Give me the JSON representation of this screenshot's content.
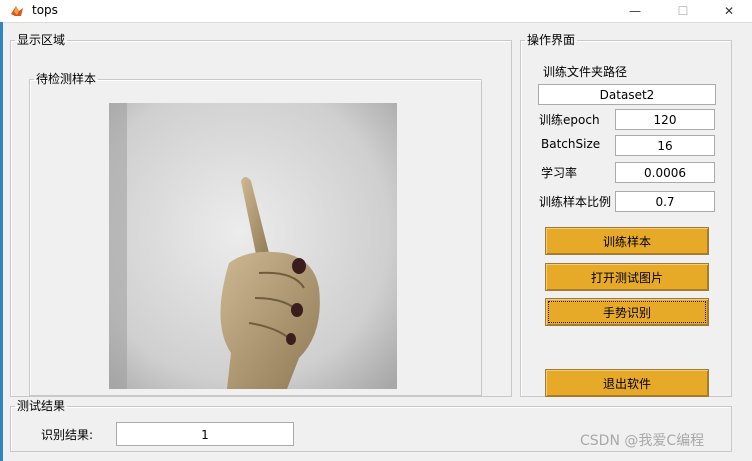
{
  "window": {
    "title": "tops",
    "minimize": "—",
    "maximize": "☐",
    "close": "✕"
  },
  "display_panel": {
    "title": "显示区域",
    "sample_group": "待检测样本"
  },
  "operation_panel": {
    "title": "操作界面",
    "folder_label": "训练文件夹路径",
    "folder_value": "Dataset2",
    "epoch_label": "训练epoch",
    "epoch_value": "120",
    "batch_label": "BatchSize",
    "batch_value": "16",
    "lr_label": "学习率",
    "lr_value": "0.0006",
    "ratio_label": "训练样本比例",
    "ratio_value": "0.7",
    "buttons": {
      "train": "训练样本",
      "open_image": "打开测试图片",
      "recognize": "手势识别",
      "exit": "退出软件"
    },
    "button_color": "#e7a928"
  },
  "result_panel": {
    "title": "测试结果",
    "label": "识别结果:",
    "value": "1"
  },
  "watermark": "CSDN @我爱C编程"
}
